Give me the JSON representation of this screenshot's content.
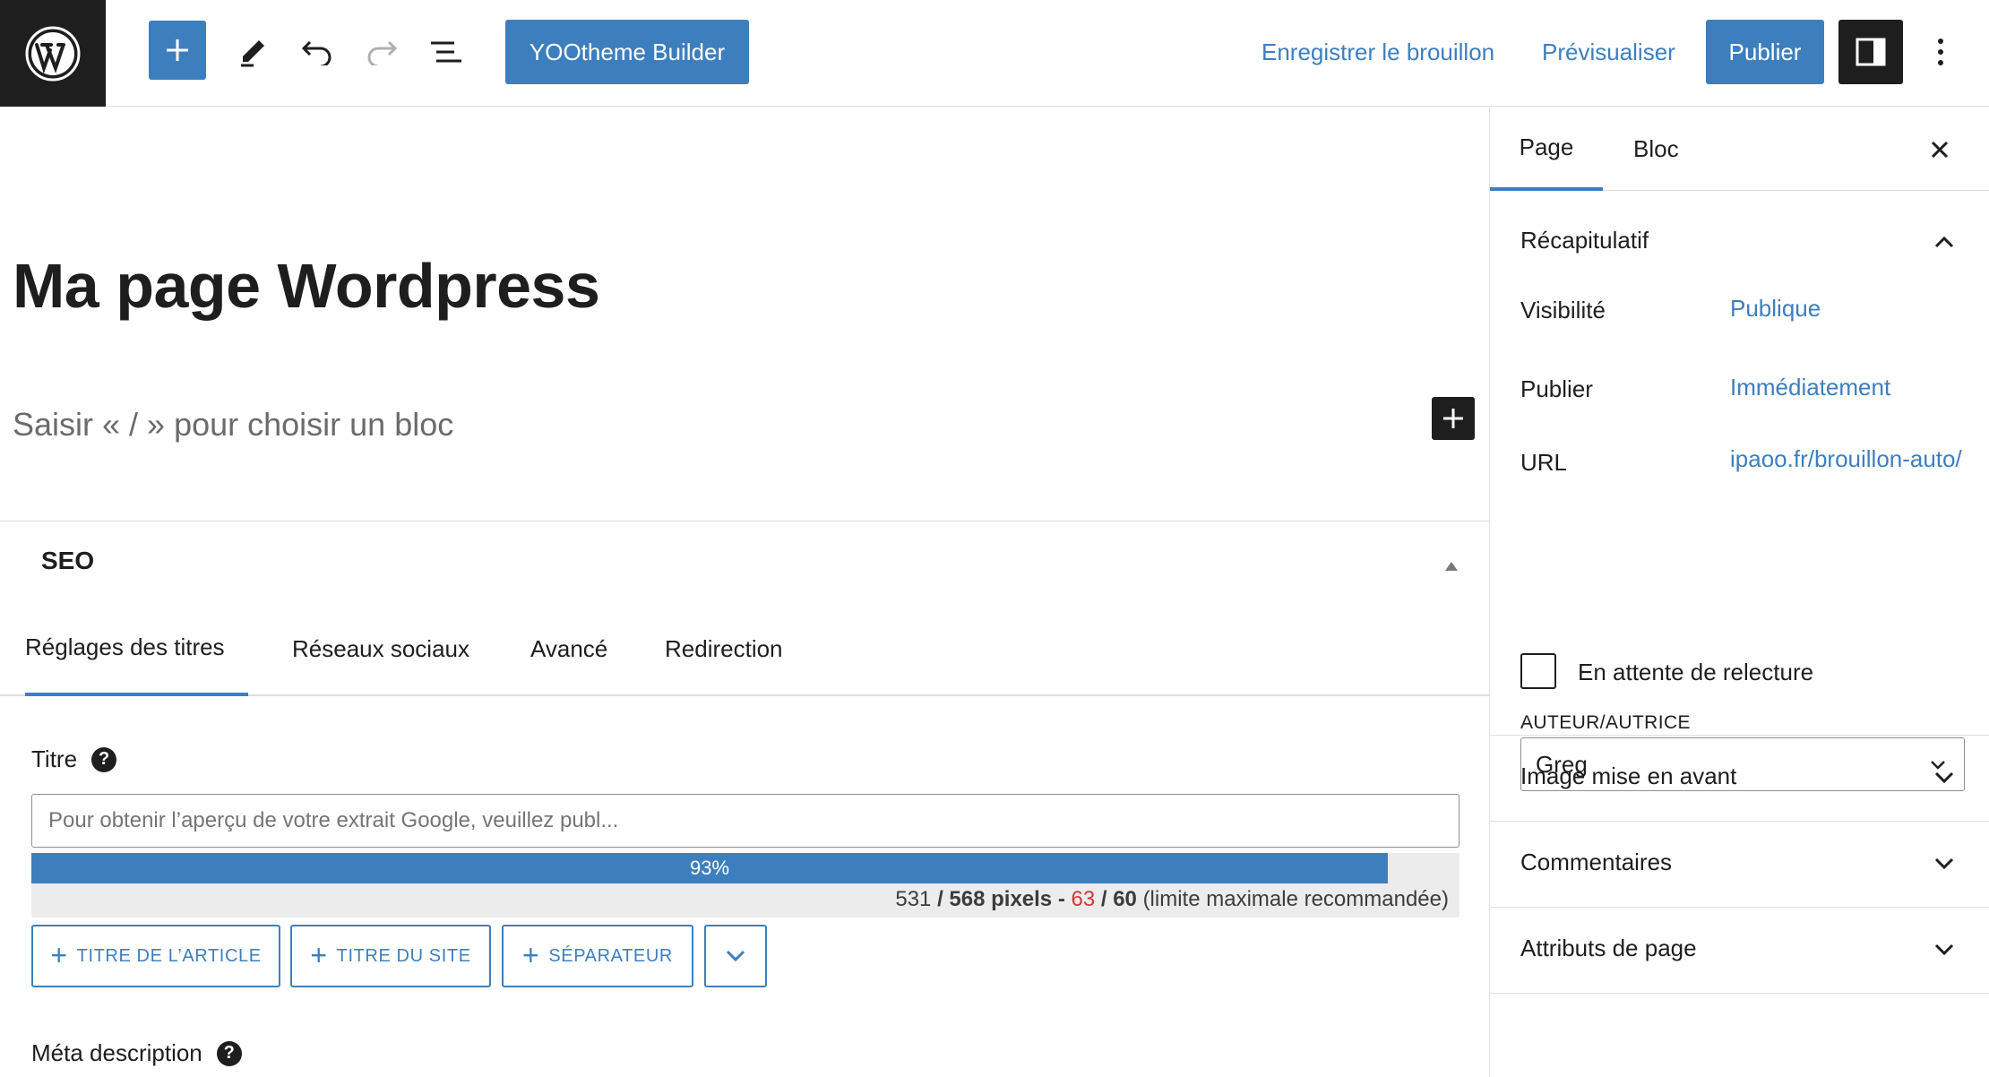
{
  "topbar": {
    "logo": "wordpress-logo-icon",
    "inserter_icon": "plus-icon",
    "tools": [
      "pencil-icon",
      "undo-icon",
      "redo-icon",
      "list-view-icon"
    ],
    "yootheme_label": "YOOtheme Builder",
    "save_draft_label": "Enregistrer le brouillon",
    "preview_label": "Prévisualiser",
    "publish_label": "Publier",
    "settings_icon": "sidebar-toggle-icon",
    "more_icon": "more-vertical-icon"
  },
  "editor": {
    "page_title": "Ma page Wordpress",
    "block_placeholder": "Saisir « / » pour choisir un bloc"
  },
  "seo": {
    "title": "SEO",
    "tabs": [
      {
        "label": "Réglages des titres",
        "active": true
      },
      {
        "label": "Réseaux sociaux",
        "active": false
      },
      {
        "label": "Avancé",
        "active": false
      },
      {
        "label": "Redirection",
        "active": false
      }
    ],
    "title_field": {
      "label": "Titre",
      "placeholder": "Pour obtenir l’aperçu de votre extrait Google, veuillez publ...",
      "progress_percent": 93,
      "progress_label": "93%",
      "pixels_used": "531",
      "pixels_sep": "/ 568 pixels -",
      "chars_used": "63",
      "chars_sep": "/ 60",
      "limit_note": "(limite maximale recommandée)"
    },
    "tag_buttons": [
      "TITRE DE L’ARTICLE",
      "TITRE DU SITE",
      "SÉPARATEUR"
    ],
    "meta_description_label": "Méta description"
  },
  "sidebar": {
    "tabs": [
      {
        "label": "Page",
        "active": true
      },
      {
        "label": "Bloc",
        "active": false
      }
    ],
    "summary": {
      "heading": "Récapitulatif",
      "rows": [
        {
          "label": "Visibilité",
          "value": "Publique"
        },
        {
          "label": "Publier",
          "value": "Immédiatement"
        },
        {
          "label": "URL",
          "value": "ipaoo.fr/brouillon-auto/"
        }
      ],
      "pending_review_label": "En attente de relecture",
      "author_caption": "AUTEUR/AUTRICE",
      "author_value": "Greg"
    },
    "panels": [
      "Image mise en avant",
      "Commentaires",
      "Attributs de page"
    ]
  },
  "colors": {
    "accent": "#3d7fbe",
    "dark": "#1e1e1e",
    "warning": "#d63638"
  }
}
